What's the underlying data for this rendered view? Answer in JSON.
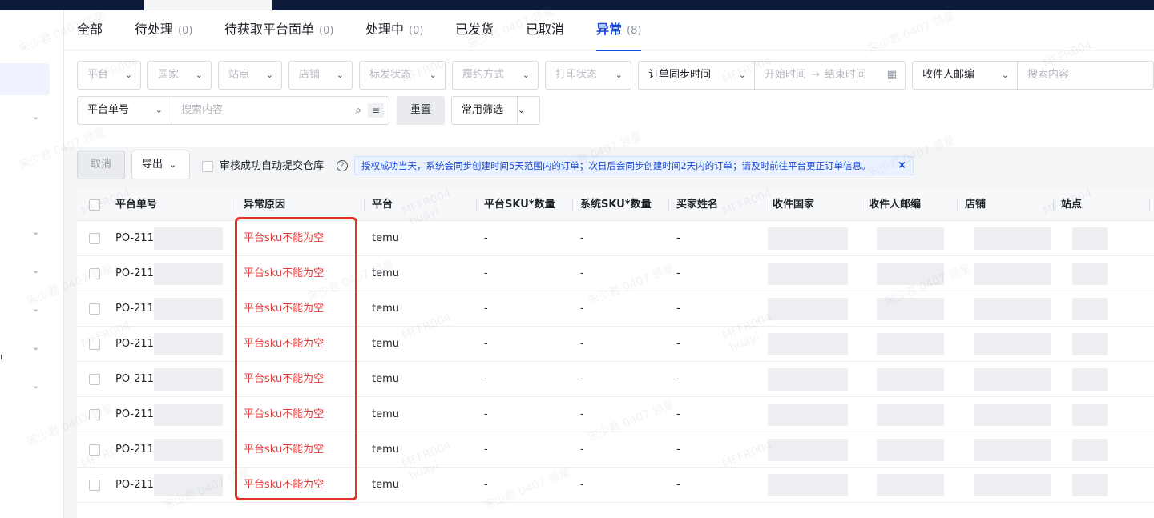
{
  "tabs": [
    {
      "label": "全部",
      "count": ""
    },
    {
      "label": "待处理",
      "count": "(0)"
    },
    {
      "label": "待获取平台面单",
      "count": "(0)"
    },
    {
      "label": "处理中",
      "count": "(0)"
    },
    {
      "label": "已发货",
      "count": ""
    },
    {
      "label": "已取消",
      "count": ""
    },
    {
      "label": "异常",
      "count": "(8)"
    }
  ],
  "filters": {
    "platform": "平台",
    "country": "国家",
    "site": "站点",
    "store": "店铺",
    "mark_status": "标发状态",
    "fulfillment": "履约方式",
    "print_status": "打印状态",
    "sync_time": "订单同步时间",
    "start_time": "开始时间",
    "end_time": "结束时间",
    "zip_select": "收件人邮编",
    "zip_search_placeholder": "搜索内容",
    "order_no_select": "平台单号",
    "order_no_placeholder": "搜索内容",
    "reset": "重置",
    "common_filter": "常用筛选"
  },
  "toolbar": {
    "cancel": "取消",
    "export": "导出",
    "auto_submit": "审核成功自动提交仓库",
    "notice": "授权成功当天，系统会同步创建时间5天范围内的订单；次日后会同步创建时间2天内的订单；请及时前往平台更正订单信息。"
  },
  "table": {
    "headers": [
      "平台单号",
      "异常原因",
      "平台",
      "平台SKU*数量",
      "系统SKU*数量",
      "买家姓名",
      "收件国家",
      "收件人邮编",
      "店铺",
      "站点"
    ],
    "rows": [
      {
        "order_no": "PO-211",
        "reason": "平台sku不能为空",
        "platform": "temu",
        "platform_sku": "-",
        "system_sku": "-",
        "buyer": "-"
      },
      {
        "order_no": "PO-211",
        "reason": "平台sku不能为空",
        "platform": "temu",
        "platform_sku": "-",
        "system_sku": "-",
        "buyer": "-"
      },
      {
        "order_no": "PO-211",
        "reason": "平台sku不能为空",
        "platform": "temu",
        "platform_sku": "-",
        "system_sku": "-",
        "buyer": "-"
      },
      {
        "order_no": "PO-211",
        "reason": "平台sku不能为空",
        "platform": "temu",
        "platform_sku": "-",
        "system_sku": "-",
        "buyer": "-"
      },
      {
        "order_no": "PO-211",
        "reason": "平台sku不能为空",
        "platform": "temu",
        "platform_sku": "-",
        "system_sku": "-",
        "buyer": "-"
      },
      {
        "order_no": "PO-211",
        "reason": "平台sku不能为空",
        "platform": "temu",
        "platform_sku": "-",
        "system_sku": "-",
        "buyer": "-"
      },
      {
        "order_no": "PO-211",
        "reason": "平台sku不能为空",
        "platform": "temu",
        "platform_sku": "-",
        "system_sku": "-",
        "buyer": "-"
      },
      {
        "order_no": "PO-211",
        "reason": "平台sku不能为空",
        "platform": "temu",
        "platform_sku": "-",
        "system_sku": "-",
        "buyer": "-"
      }
    ]
  },
  "watermarks": [
    "宋少君 0407 领星",
    "MFFR004",
    "huayi"
  ],
  "colors": {
    "accent": "#1a4bd6",
    "error": "#e23b3b",
    "highlight_box": "#e0342d"
  }
}
